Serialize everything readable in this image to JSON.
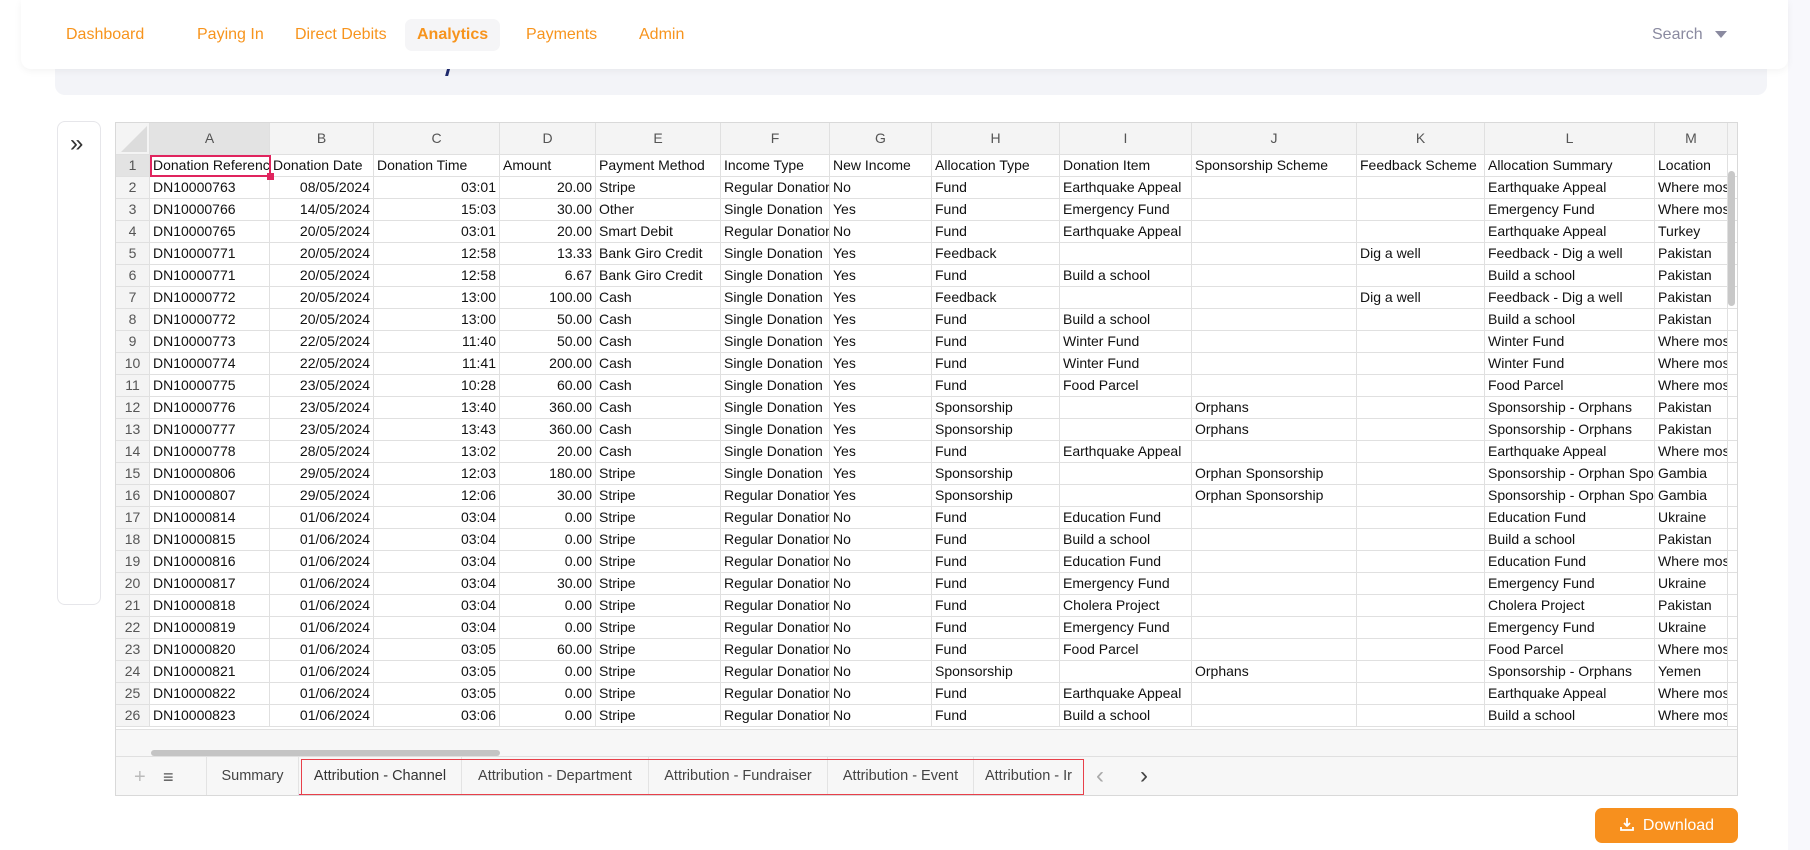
{
  "nav": {
    "items": [
      {
        "label": "Dashboard"
      },
      {
        "label": "Paying In"
      },
      {
        "label": "Direct Debits"
      },
      {
        "label": "Analytics",
        "active": true
      },
      {
        "label": "Payments"
      },
      {
        "label": "Admin"
      }
    ],
    "search_label": "Search"
  },
  "colors": {
    "accent": "#f7941d",
    "selection": "#e0245e",
    "button": "#f7901e"
  },
  "sidebar_toggle": {
    "icon": "double-chevron-right-icon",
    "glyph": "»"
  },
  "sheet": {
    "col_letters": [
      "A",
      "B",
      "C",
      "D",
      "E",
      "F",
      "G",
      "H",
      "I",
      "J",
      "K",
      "L",
      "M",
      ""
    ],
    "selected_cell": "A1",
    "rows": [
      [
        "Donation Reference",
        "Donation Date",
        "Donation Time",
        "Amount",
        "Payment Method",
        "Income Type",
        "New Income",
        "Allocation Type",
        "Donation Item",
        "Sponsorship Scheme",
        "Feedback Scheme",
        "Allocation Summary",
        "Location",
        ""
      ],
      [
        "DN10000763",
        "08/05/2024",
        "03:01",
        "20.00",
        "Stripe",
        "Regular Donation",
        "No",
        "Fund",
        "Earthquake Appeal",
        "",
        "",
        "Earthquake Appeal",
        "Where most needed",
        ""
      ],
      [
        "DN10000766",
        "14/05/2024",
        "15:03",
        "30.00",
        "Other",
        "Single Donation",
        "Yes",
        "Fund",
        "Emergency Fund",
        "",
        "",
        "Emergency Fund",
        "Where most needed",
        ""
      ],
      [
        "DN10000765",
        "20/05/2024",
        "03:01",
        "20.00",
        "Smart Debit",
        "Regular Donation",
        "No",
        "Fund",
        "Earthquake Appeal",
        "",
        "",
        "Earthquake Appeal",
        "Turkey",
        ""
      ],
      [
        "DN10000771",
        "20/05/2024",
        "12:58",
        "13.33",
        "Bank Giro Credit",
        "Single Donation",
        "Yes",
        "Feedback",
        "",
        "",
        "Dig a well",
        "Feedback - Dig a well",
        "Pakistan",
        ""
      ],
      [
        "DN10000771",
        "20/05/2024",
        "12:58",
        "6.67",
        "Bank Giro Credit",
        "Single Donation",
        "Yes",
        "Fund",
        "Build a school",
        "",
        "",
        "Build a school",
        "Pakistan",
        ""
      ],
      [
        "DN10000772",
        "20/05/2024",
        "13:00",
        "100.00",
        "Cash",
        "Single Donation",
        "Yes",
        "Feedback",
        "",
        "",
        "Dig a well",
        "Feedback - Dig a well",
        "Pakistan",
        ""
      ],
      [
        "DN10000772",
        "20/05/2024",
        "13:00",
        "50.00",
        "Cash",
        "Single Donation",
        "Yes",
        "Fund",
        "Build a school",
        "",
        "",
        "Build a school",
        "Pakistan",
        ""
      ],
      [
        "DN10000773",
        "22/05/2024",
        "11:40",
        "50.00",
        "Cash",
        "Single Donation",
        "Yes",
        "Fund",
        "Winter Fund",
        "",
        "",
        "Winter Fund",
        "Where most needed",
        ""
      ],
      [
        "DN10000774",
        "22/05/2024",
        "11:41",
        "200.00",
        "Cash",
        "Single Donation",
        "Yes",
        "Fund",
        "Winter Fund",
        "",
        "",
        "Winter Fund",
        "Where most needed",
        ""
      ],
      [
        "DN10000775",
        "23/05/2024",
        "10:28",
        "60.00",
        "Cash",
        "Single Donation",
        "Yes",
        "Fund",
        "Food Parcel",
        "",
        "",
        "Food Parcel",
        "Where most needed",
        ""
      ],
      [
        "DN10000776",
        "23/05/2024",
        "13:40",
        "360.00",
        "Cash",
        "Single Donation",
        "Yes",
        "Sponsorship",
        "",
        "Orphans",
        "",
        "Sponsorship - Orphans",
        "Pakistan",
        ""
      ],
      [
        "DN10000777",
        "23/05/2024",
        "13:43",
        "360.00",
        "Cash",
        "Single Donation",
        "Yes",
        "Sponsorship",
        "",
        "Orphans",
        "",
        "Sponsorship - Orphans",
        "Pakistan",
        ""
      ],
      [
        "DN10000778",
        "28/05/2024",
        "13:02",
        "20.00",
        "Cash",
        "Single Donation",
        "Yes",
        "Fund",
        "Earthquake Appeal",
        "",
        "",
        "Earthquake Appeal",
        "Where most needed",
        ""
      ],
      [
        "DN10000806",
        "29/05/2024",
        "12:03",
        "180.00",
        "Stripe",
        "Single Donation",
        "Yes",
        "Sponsorship",
        "",
        "Orphan Sponsorship",
        "",
        "Sponsorship - Orphan Sponsorship",
        "Gambia",
        ""
      ],
      [
        "DN10000807",
        "29/05/2024",
        "12:06",
        "30.00",
        "Stripe",
        "Regular Donation",
        "Yes",
        "Sponsorship",
        "",
        "Orphan Sponsorship",
        "",
        "Sponsorship - Orphan Sponsorship",
        "Gambia",
        ""
      ],
      [
        "DN10000814",
        "01/06/2024",
        "03:04",
        "0.00",
        "Stripe",
        "Regular Donation",
        "No",
        "Fund",
        "Education Fund",
        "",
        "",
        "Education Fund",
        "Ukraine",
        ""
      ],
      [
        "DN10000815",
        "01/06/2024",
        "03:04",
        "0.00",
        "Stripe",
        "Regular Donation",
        "No",
        "Fund",
        "Build a school",
        "",
        "",
        "Build a school",
        "Pakistan",
        ""
      ],
      [
        "DN10000816",
        "01/06/2024",
        "03:04",
        "0.00",
        "Stripe",
        "Regular Donation",
        "No",
        "Fund",
        "Education Fund",
        "",
        "",
        "Education Fund",
        "Where most needed",
        ""
      ],
      [
        "DN10000817",
        "01/06/2024",
        "03:04",
        "30.00",
        "Stripe",
        "Regular Donation",
        "No",
        "Fund",
        "Emergency Fund",
        "",
        "",
        "Emergency Fund",
        "Ukraine",
        ""
      ],
      [
        "DN10000818",
        "01/06/2024",
        "03:04",
        "0.00",
        "Stripe",
        "Regular Donation",
        "No",
        "Fund",
        "Cholera Project",
        "",
        "",
        "Cholera Project",
        "Pakistan",
        ""
      ],
      [
        "DN10000819",
        "01/06/2024",
        "03:04",
        "0.00",
        "Stripe",
        "Regular Donation",
        "No",
        "Fund",
        "Emergency Fund",
        "",
        "",
        "Emergency Fund",
        "Ukraine",
        ""
      ],
      [
        "DN10000820",
        "01/06/2024",
        "03:05",
        "60.00",
        "Stripe",
        "Regular Donation",
        "No",
        "Fund",
        "Food Parcel",
        "",
        "",
        "Food Parcel",
        "Where most needed",
        ""
      ],
      [
        "DN10000821",
        "01/06/2024",
        "03:05",
        "0.00",
        "Stripe",
        "Regular Donation",
        "No",
        "Sponsorship",
        "",
        "Orphans",
        "",
        "Sponsorship - Orphans",
        "Yemen",
        ""
      ],
      [
        "DN10000822",
        "01/06/2024",
        "03:05",
        "0.00",
        "Stripe",
        "Regular Donation",
        "No",
        "Fund",
        "Earthquake Appeal",
        "",
        "",
        "Earthquake Appeal",
        "Where most needed",
        ""
      ],
      [
        "DN10000823",
        "01/06/2024",
        "03:06",
        "0.00",
        "Stripe",
        "Regular Donation",
        "No",
        "Fund",
        "Build a school",
        "",
        "",
        "Build a school",
        "Where most needed",
        ""
      ]
    ],
    "tabs": [
      {
        "label": "Summary"
      },
      {
        "label": "Attribution - Channel",
        "active": true
      },
      {
        "label": "Attribution - Department"
      },
      {
        "label": "Attribution - Fundraiser"
      },
      {
        "label": "Attribution - Event"
      },
      {
        "label": "Attribution - Ir"
      }
    ],
    "add_sheet_glyph": "+",
    "menu_glyph": "≡",
    "prev_glyph": "‹",
    "next_glyph": "›"
  },
  "download": {
    "label": "Download",
    "icon": "download-icon"
  }
}
